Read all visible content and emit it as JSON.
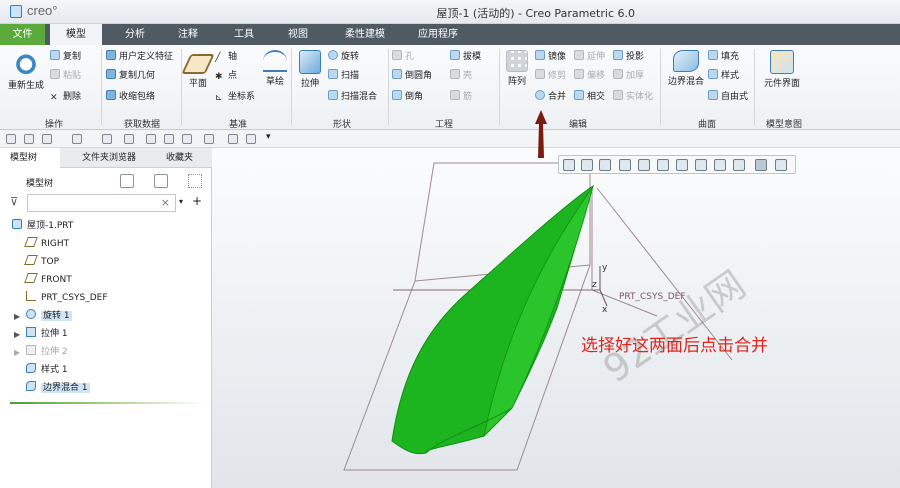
{
  "title_bar": {
    "logo": "creo°",
    "window_title": "屋顶-1 (活动的) - Creo Parametric 6.0"
  },
  "tabs": [
    {
      "label": "文件"
    },
    {
      "label": "模型"
    },
    {
      "label": "分析"
    },
    {
      "label": "注释"
    },
    {
      "label": "工具"
    },
    {
      "label": "视图"
    },
    {
      "label": "柔性建模"
    },
    {
      "label": "应用程序"
    }
  ],
  "ribbon": {
    "operations": {
      "regenerate": "重新生成",
      "copy": "复制",
      "paste": "粘贴",
      "delete": "删除",
      "group_label": "操作"
    },
    "get_data": {
      "udf": "用户定义特征",
      "copy_geometry": "复制几何",
      "shrinkwrap": "收缩包络",
      "group_label": "获取数据"
    },
    "datum": {
      "plane": "平面",
      "axis": "轴",
      "point": "点",
      "csys": "坐标系",
      "sketch": "草绘",
      "group_label": "基准"
    },
    "shapes": {
      "extrude": "拉伸",
      "revolve": "旋转",
      "sweep": "扫描",
      "swept_blend": "扫描混合",
      "group_label": "形状"
    },
    "engineering": {
      "hole": "孔",
      "round": "倒圆角",
      "chamfer": "倒角",
      "draft": "拔模",
      "shell": "壳",
      "rib": "筋",
      "group_label": "工程"
    },
    "editing": {
      "pattern": "阵列",
      "mirror": "镜像",
      "extend": "延伸",
      "project": "投影",
      "trim": "修剪",
      "offset": "偏移",
      "thicken": "加厚",
      "merge": "合并",
      "intersect": "相交",
      "solidify": "实体化",
      "group_label": "编辑"
    },
    "surfaces": {
      "boundary_blend": "边界混合",
      "fill": "填充",
      "style": "样式",
      "freestyle": "自由式",
      "group_label": "曲面"
    },
    "model_intent": {
      "component_interface": "元件界面",
      "group_label": "模型意图"
    }
  },
  "panel": {
    "tabs": [
      "模型树",
      "文件夹浏览器",
      "收藏夹"
    ],
    "tree_header": "模型树",
    "filter_placeholder": "",
    "tree": [
      {
        "label": "屋顶-1.PRT",
        "icon": "part-icon"
      },
      {
        "label": "RIGHT",
        "icon": "datum-plane-icon"
      },
      {
        "label": "TOP",
        "icon": "datum-plane-icon"
      },
      {
        "label": "FRONT",
        "icon": "datum-plane-icon"
      },
      {
        "label": "PRT_CSYS_DEF",
        "icon": "csys-icon"
      },
      {
        "label": "旋转 1",
        "icon": "revolve-icon",
        "state": "highlighted"
      },
      {
        "label": "拉伸 1",
        "icon": "extrude-icon"
      },
      {
        "label": "拉伸 2",
        "icon": "extrude-icon",
        "state": "suppressed"
      },
      {
        "label": "样式 1",
        "icon": "style-icon"
      },
      {
        "label": "边界混合 1",
        "icon": "boundary-blend-icon",
        "state": "highlighted"
      }
    ]
  },
  "viewport": {
    "csys_label": "PRT_CSYS_DEF",
    "axis_labels": {
      "x": "x",
      "y": "y",
      "z": "z"
    },
    "annotation": "选择好这两面后点击合并",
    "watermark": "92工业网",
    "surface_color": "#19b21b"
  },
  "colors": {
    "file_tab": "#5aab3c",
    "tab_bar": "#505a63",
    "annotation": "#e0241b",
    "highlight": "#cfe5f6"
  }
}
